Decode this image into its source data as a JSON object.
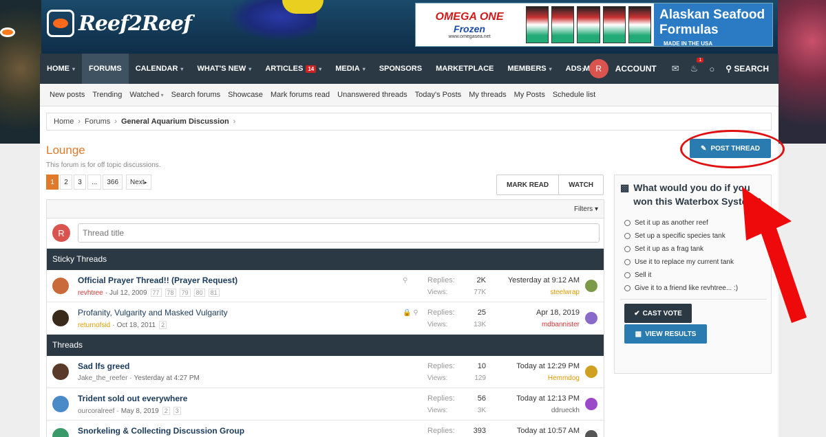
{
  "header": {
    "logo_text": "Reef2Reef",
    "ad": {
      "brand_line1": "OMEGA ONE",
      "brand_line2": "Frozen",
      "brand_url": "www.omegasea.net",
      "headline1": "Alaskan Seafood",
      "headline2": "Formulas",
      "made_in": "MADE IN THE USA"
    }
  },
  "nav": {
    "items": [
      {
        "label": "HOME",
        "caret": true,
        "active": false
      },
      {
        "label": "FORUMS",
        "caret": false,
        "active": true
      },
      {
        "label": "CALENDAR",
        "caret": true,
        "active": false
      },
      {
        "label": "WHAT'S NEW",
        "caret": true,
        "active": false
      },
      {
        "label": "ARTICLES",
        "badge": "14",
        "caret": true,
        "active": false
      },
      {
        "label": "MEDIA",
        "caret": true,
        "active": false
      },
      {
        "label": "SPONSORS",
        "caret": false,
        "active": false
      },
      {
        "label": "MARKETPLACE",
        "caret": false,
        "active": false
      },
      {
        "label": "MEMBERS",
        "caret": true,
        "active": false
      },
      {
        "label": "ADS MAN",
        "caret": false,
        "active": false
      }
    ],
    "avatar_letter": "R",
    "account_label": "ACCOUNT",
    "alerts_count": "1",
    "search_label": "SEARCH"
  },
  "subnav": [
    "New posts",
    "Trending",
    "Watched",
    "Search forums",
    "Showcase",
    "Mark forums read",
    "Unanswered threads",
    "Today's Posts",
    "My threads",
    "My Posts",
    "Schedule list"
  ],
  "breadcrumb": [
    "Home",
    "Forums",
    "General Aquarium Discussion"
  ],
  "forum": {
    "title": "Lounge",
    "description": "This forum is for off topic discussions.",
    "post_thread_label": "POST THREAD",
    "pages": [
      "1",
      "2",
      "3",
      "...",
      "366"
    ],
    "next_label": "Next",
    "mark_read_label": "MARK READ",
    "watch_label": "WATCH",
    "filters_label": "Filters",
    "quick_avatar": "R",
    "thread_title_placeholder": "Thread title",
    "sticky_header": "Sticky Threads",
    "threads_header": "Threads"
  },
  "sticky_threads": [
    {
      "title": "Official Prayer Thread!! (Prayer Request)",
      "bold": true,
      "author": "revhtree",
      "author_color": "red",
      "date": "Jul 12, 2009",
      "pages": [
        "77",
        "78",
        "79",
        "80",
        "81"
      ],
      "icons": "⚲",
      "replies_label": "Replies:",
      "replies": "2K",
      "views_label": "Views:",
      "views": "77K",
      "last_date": "Yesterday at 9:12 AM",
      "last_user": "steelwrap",
      "last_color": "orange",
      "avatar_color": "#c96a3a",
      "last_avatar_color": "#7a9a4a"
    },
    {
      "title": "Profanity, Vulgarity and Masked Vulgarity",
      "bold": false,
      "author": "returnofsid",
      "author_color": "orange",
      "date": "Oct 18, 2011",
      "pages": [
        "2"
      ],
      "icons": "🔒 ⚲",
      "replies_label": "Replies:",
      "replies": "25",
      "views_label": "Views:",
      "views": "13K",
      "last_date": "Apr 18, 2019",
      "last_user": "mdbannister",
      "last_color": "red",
      "avatar_color": "#3a2a1a",
      "last_avatar_color": "#8a6ac9"
    }
  ],
  "threads": [
    {
      "title": "Sad lfs greed",
      "bold": true,
      "author": "Jake_the_reefer",
      "author_color": "gray",
      "date": "Yesterday at 4:27 PM",
      "pages": [],
      "icons": "",
      "replies_label": "Replies:",
      "replies": "10",
      "views_label": "Views:",
      "views": "129",
      "last_date": "Today at 12:29 PM",
      "last_user": "Hemmdog",
      "last_color": "orange",
      "avatar_color": "#5a3a2a",
      "last_avatar_color": "#d0a020"
    },
    {
      "title": "Trident sold out everywhere",
      "bold": true,
      "author": "ourcoralreef",
      "author_color": "gray",
      "date": "May 8, 2019",
      "pages": [
        "2",
        "3"
      ],
      "icons": "",
      "replies_label": "Replies:",
      "replies": "56",
      "views_label": "Views:",
      "views": "3K",
      "last_date": "Today at 12:13 PM",
      "last_user": "ddrueckh",
      "last_color": "gray",
      "avatar_color": "#4a8ac9",
      "last_avatar_color": "#9a4ac9"
    },
    {
      "title": "Snorkeling & Collecting Discussion Group",
      "bold": true,
      "author": "",
      "author_color": "gray",
      "date": "",
      "pages": [],
      "icons": "",
      "replies_label": "Replies:",
      "replies": "393",
      "views_label": "",
      "views": "",
      "last_date": "Today at 10:57 AM",
      "last_user": "",
      "last_color": "gray",
      "avatar_color": "#3a9a6a",
      "last_avatar_color": "#555555"
    }
  ],
  "poll": {
    "question": "What would you do if you won this Waterbox System?",
    "options": [
      "Set it up as another reef",
      "Set up a specific species tank",
      "Set it up as a frag tank",
      "Use it to replace my current tank",
      "Sell it",
      "Give it to a friend like revhtree... :)"
    ],
    "cast_vote_label": "CAST VOTE",
    "view_results_label": "VIEW RESULTS"
  },
  "colors": {
    "accent": "#e07a2a",
    "nav_bg": "#2b3945",
    "primary_button": "#2a7bb0",
    "annotation_red": "#e01010"
  }
}
